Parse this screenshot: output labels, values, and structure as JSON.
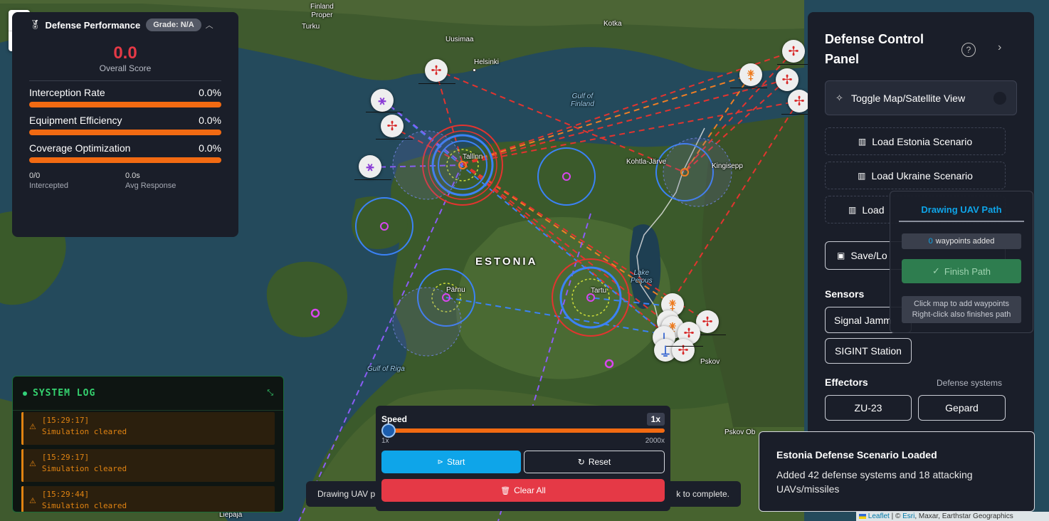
{
  "map": {
    "labels": {
      "finland_proper": "Finland\nProper",
      "turku": "Turku",
      "uusimaa": "Uusimaa",
      "helsinki": "Helsinki",
      "kotka": "Kotka",
      "gulf_finland": "Gulf of\nFinland",
      "tallinn": "Tallinn",
      "kohtla_jarve": "Kohtla-Järve",
      "kingisepp": "Kingisepp",
      "estonia": "ESTONIA",
      "parnu": "Pärnu",
      "tartu": "Tartu",
      "lake_peipus": "Lake\nPeipus",
      "gulf_riga": "Gulf of Riga",
      "pskov": "Pskov",
      "pskov_oblast": "Pskov Ob",
      "liepaja": "Liepaja"
    }
  },
  "zoom": {
    "in": "+",
    "out": "−"
  },
  "performance": {
    "title": "Defense Performance",
    "grade": "Grade: N/A",
    "score": "0.0",
    "score_label": "Overall Score",
    "metrics": [
      {
        "label": "Interception Rate",
        "value": "0.0%"
      },
      {
        "label": "Equipment Efficiency",
        "value": "0.0%"
      },
      {
        "label": "Coverage Optimization",
        "value": "0.0%"
      }
    ],
    "intercepted_value": "0/0",
    "intercepted_label": "Intercepted",
    "response_value": "0.0s",
    "response_label": "Avg Response"
  },
  "system_log": {
    "title": "SYSTEM LOG",
    "entries": [
      {
        "time": "[15:29:17]",
        "message": "Simulation cleared"
      },
      {
        "time": "[15:29:17]",
        "message": "Simulation cleared"
      },
      {
        "time": "[15:29:44]",
        "message": "Simulation cleared"
      }
    ]
  },
  "hint": {
    "left": "Drawing UAV p",
    "right": "k to complete."
  },
  "controls": {
    "speed_label": "Speed",
    "speed_value": "1x",
    "speed_fraction": 0.0,
    "range_min": "1x",
    "range_max": "2000x",
    "start": "Start",
    "reset": "Reset",
    "clear_all": "Clear All"
  },
  "panel": {
    "title": "Defense Control Panel",
    "toggle_view": "Toggle Map/Satellite View",
    "load_estonia": "Load Estonia Scenario",
    "load_ukraine": "Load Ukraine Scenario",
    "load_third": "Load",
    "save_load": "Save/Lo",
    "sensors_label": "Sensors",
    "signal_jammer": "Signal Jamm",
    "sigint": "SIGINT Station",
    "effectors_label": "Effectors",
    "effectors_sub": "Defense systems",
    "zu23": "ZU-23",
    "gepard": "Gepard"
  },
  "drawing": {
    "title": "Drawing UAV Path",
    "waypoints_count": "0",
    "waypoints_label": "waypoints added",
    "finish": "Finish Path",
    "help_line1": "Click map to add waypoints",
    "help_line2": "Right-click also finishes path"
  },
  "toast": {
    "title": "Estonia Defense Scenario Loaded",
    "body": "Added 42 defense systems and 18 attacking UAVs/missiles"
  },
  "attribution": {
    "leaflet": "Leaflet",
    "sep": " | © ",
    "esri": "Esri",
    "rest": ", Maxar, Earthstar Geographics"
  },
  "colors": {
    "accent_orange": "#f26a12",
    "score_red": "#e53946",
    "start_blue": "#0ea5e9",
    "log_green": "#35d26f",
    "log_warning": "#e08312"
  }
}
